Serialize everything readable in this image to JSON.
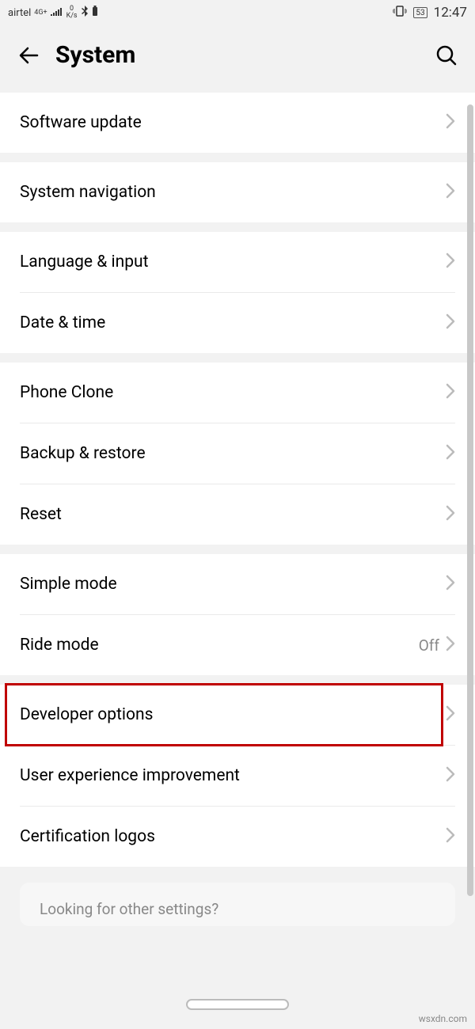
{
  "status": {
    "carrier": "airtel",
    "network_sup": "4G+",
    "speed_top": "0",
    "speed_bottom": "K/s",
    "battery": "53",
    "time": "12:47"
  },
  "header": {
    "title": "System"
  },
  "sections": [
    {
      "items": [
        {
          "label": "Software update"
        }
      ]
    },
    {
      "items": [
        {
          "label": "System navigation"
        }
      ]
    },
    {
      "items": [
        {
          "label": "Language & input"
        },
        {
          "label": "Date & time"
        }
      ]
    },
    {
      "items": [
        {
          "label": "Phone Clone"
        },
        {
          "label": "Backup & restore"
        },
        {
          "label": "Reset"
        }
      ]
    },
    {
      "items": [
        {
          "label": "Simple mode"
        },
        {
          "label": "Ride mode",
          "value": "Off"
        }
      ]
    },
    {
      "items": [
        {
          "label": "Developer options",
          "highlighted": true
        },
        {
          "label": "User experience improvement"
        },
        {
          "label": "Certification logos"
        }
      ]
    }
  ],
  "footer": {
    "prompt": "Looking for other settings?"
  },
  "watermark": "wsxdn.com"
}
